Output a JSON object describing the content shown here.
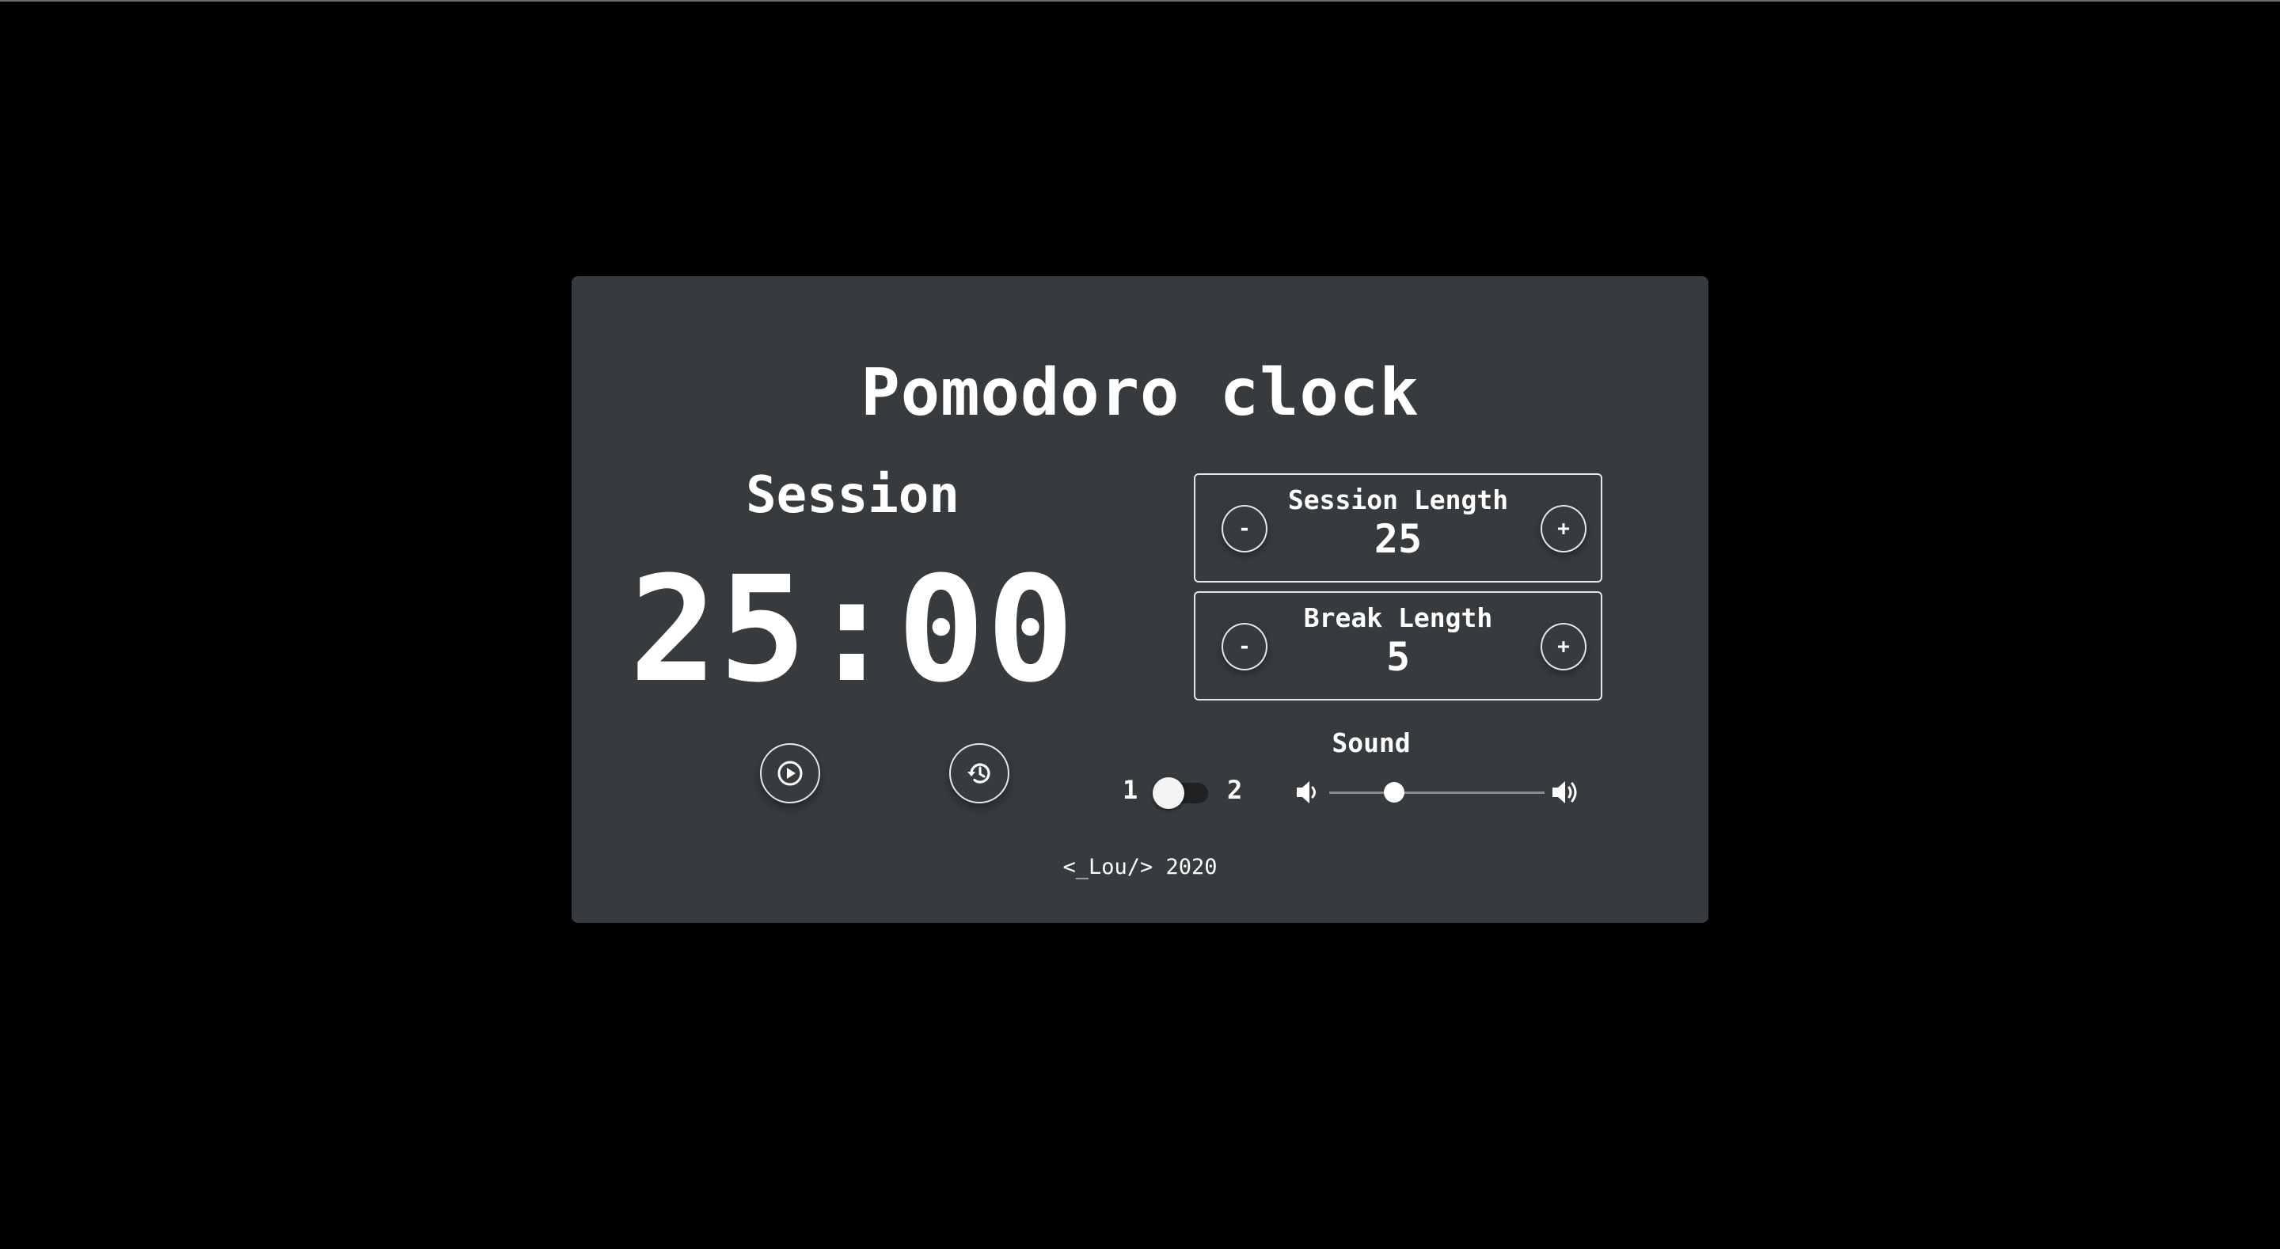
{
  "app": {
    "title": "Pomodoro clock"
  },
  "timer": {
    "label": "Session",
    "time": "25:00"
  },
  "controls": {
    "play_icon": "play-circle-icon",
    "reset_icon": "history-reset-icon"
  },
  "session_length": {
    "label": "Session Length",
    "value": "25",
    "decrement": "-",
    "increment": "+"
  },
  "break_length": {
    "label": "Break Length",
    "value": "5",
    "decrement": "-",
    "increment": "+"
  },
  "sound": {
    "label": "Sound",
    "option_1": "1",
    "option_2": "2",
    "selected_option": 1,
    "volume_fraction": 0.3,
    "volume_low_icon": "volume-low-icon",
    "volume_high_icon": "volume-high-icon"
  },
  "footer": {
    "text": "<_Lou/> 2020"
  },
  "colors": {
    "background": "#000000",
    "card": "#373b3e",
    "text": "#ffffff",
    "toggle_track": "#1f2123"
  }
}
